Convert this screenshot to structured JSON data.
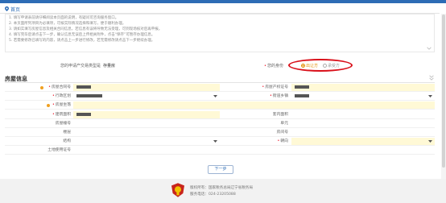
{
  "breadcrumb": {
    "label": "首页"
  },
  "notes": [
    "1. 填写申请表前请仔细阅读本页面的说明，有疑问可咨询服务窗口。",
    "2. 本页面所列项目为必填项，可按实际情况选择和填写，便于顺利办理。",
    "3. 请如实填写房屋信息及相关合同信息，若信息有误将导致无法受理，可到现场核对后再申报。",
    "4. 填写完毕后请点击下一步，确认信息无误后上传相关附件，点击“保存”可暂存办理信息。",
    "5. 若需要修改已填写的内容，请点击上一步进行修改，若无需修改请点击下一步继续办理。"
  ],
  "role": {
    "label": "您的申请产交易类型是",
    "value": "存量房",
    "party_label": "您的身份",
    "options": [
      "出让方",
      "承受方"
    ],
    "selected": "出让方"
  },
  "sections": {
    "house_info": "房屋信息"
  },
  "house": {
    "cert_label": "房屋合同号",
    "cert_value": "",
    "property_cert_label": "房屋产权证号",
    "district_label": "行政区划",
    "street_label": "街道乡镇",
    "address_label": "房屋坐落",
    "build_area_label": "建筑面积",
    "suite_area_label": "套内面积",
    "building_no_label": "房屋幢号",
    "unit_label": "单元",
    "floor_label": "楼层",
    "room_no_label": "房间号",
    "structure_label": "结构",
    "orientation_label": "朝向",
    "land_use_label": "土地使用证号"
  },
  "buttons": {
    "next": "下一步"
  },
  "footer": {
    "copyright": "版权所有：国家税务总局辽宁省税务局",
    "hotline": "服务电话：024-23205088"
  },
  "colors": {
    "accent": "#2d6cb5",
    "highlight_circle": "#d9101a",
    "selected_radio": "#e38b00"
  }
}
